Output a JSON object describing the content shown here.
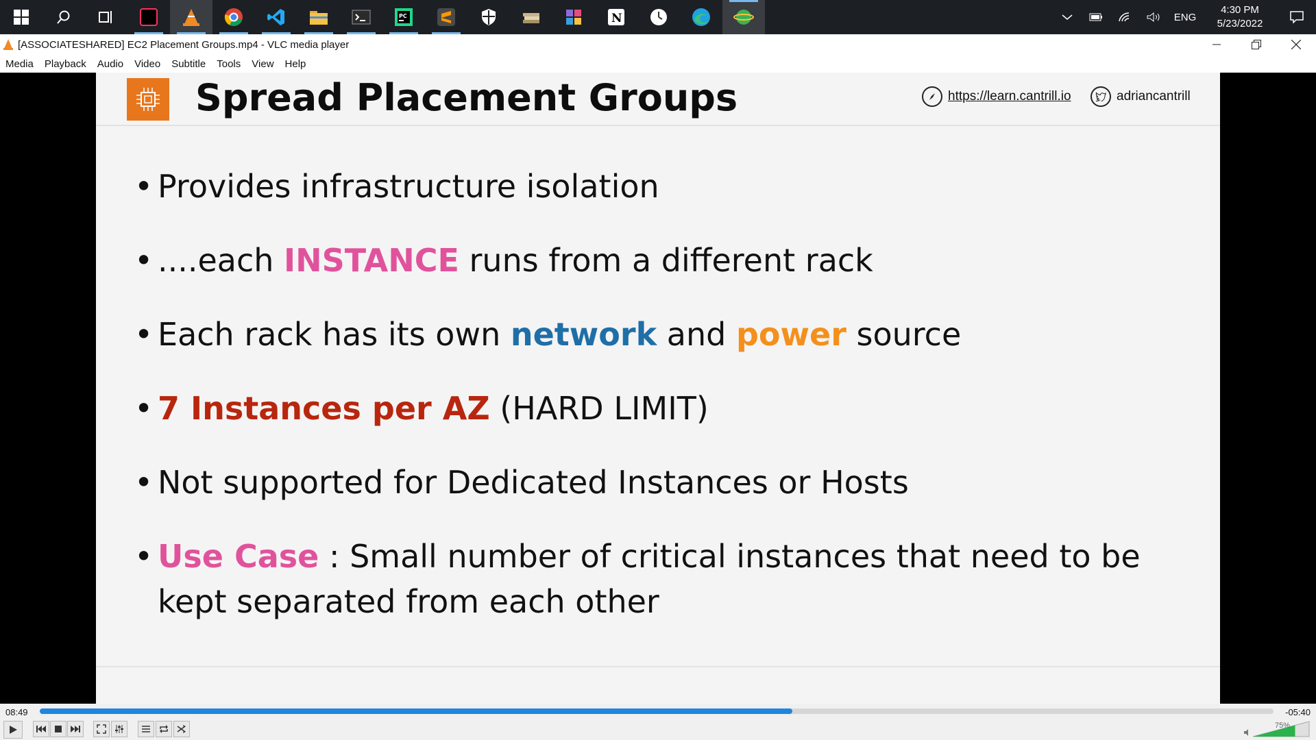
{
  "taskbar": {
    "apps": [
      {
        "name": "start",
        "color": "#ffffff"
      },
      {
        "name": "search",
        "color": "#ffffff"
      },
      {
        "name": "task-view",
        "color": "#ffffff"
      },
      {
        "name": "intellij",
        "color": "#fe315d"
      },
      {
        "name": "vlc",
        "color": "#f08a24"
      },
      {
        "name": "chrome",
        "color": "#4caf50"
      },
      {
        "name": "vscode",
        "color": "#23a9f2"
      },
      {
        "name": "file-explorer",
        "color": "#f7c244"
      },
      {
        "name": "terminal",
        "color": "#6b6b6b"
      },
      {
        "name": "pycharm",
        "color": "#21d789"
      },
      {
        "name": "sublime",
        "color": "#ff9800"
      },
      {
        "name": "security",
        "color": "#ffffff"
      },
      {
        "name": "books",
        "color": "#c9b38a"
      },
      {
        "name": "grid-app",
        "color": "#8e6bd8"
      },
      {
        "name": "notion",
        "color": "#ffffff"
      },
      {
        "name": "clock-app",
        "color": "#ffffff"
      },
      {
        "name": "edge",
        "color": "#1fa2e0"
      },
      {
        "name": "download-manager",
        "color": "#3fb24f"
      }
    ],
    "tray": {
      "language": "ENG",
      "time": "4:30 PM",
      "date": "5/23/2022"
    }
  },
  "window": {
    "title": "[ASSOCIATESHARED] EC2 Placement Groups.mp4 - VLC media player",
    "menu": [
      "Media",
      "Playback",
      "Audio",
      "Video",
      "Subtitle",
      "Tools",
      "View",
      "Help"
    ]
  },
  "slide": {
    "title": "Spread Placement Groups",
    "link_url": "https://learn.cantrill.io",
    "twitter": "adriancantrill",
    "bullets": {
      "b1": "Provides infrastructure isolation",
      "b2_pre": "....each ",
      "b2_hl": "INSTANCE",
      "b2_post": " runs from a different rack",
      "b3_pre": "Each rack has its own ",
      "b3_hl1": "network",
      "b3_mid": " and ",
      "b3_hl2": "power",
      "b3_post": " source",
      "b4_hl": "7 Instances per AZ",
      "b4_post": " (HARD LIMIT)",
      "b5": "Not supported for Dedicated Instances or Hosts",
      "b6_hl": "Use Case",
      "b6_line1": " : Small number of critical instances that need to be",
      "b6_line2": "kept separated from each other"
    },
    "colors": {
      "pink": "#e0539c",
      "blue": "#1f6ea7",
      "orange": "#f3901d",
      "red": "#b8260e"
    }
  },
  "player": {
    "elapsed": "08:49",
    "remaining": "-05:40",
    "progress": 0.61,
    "volume": "75%"
  }
}
